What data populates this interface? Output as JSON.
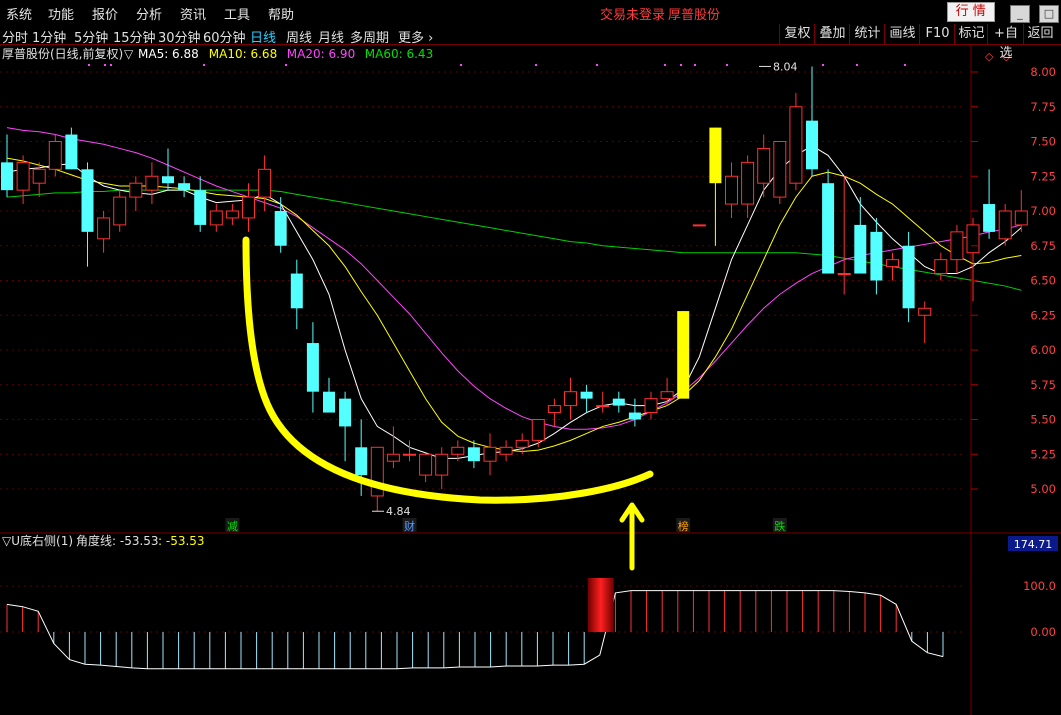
{
  "menubar": {
    "items": [
      "系统",
      "功能",
      "报价",
      "分析",
      "资讯",
      "工具",
      "帮助"
    ],
    "status_text": "交易未登录",
    "stock_name": "厚普股份",
    "quote_button": "行 情"
  },
  "periodbar": {
    "periods": [
      "分时",
      "1分钟",
      "5分钟",
      "15分钟",
      "30分钟",
      "60分钟",
      "日线",
      "周线",
      "月线",
      "多周期",
      "更多"
    ],
    "active": "日线",
    "tools": [
      "复权",
      "叠加",
      "统计",
      "画线",
      "F10",
      "标记",
      "+自选",
      "返回"
    ]
  },
  "main_header": {
    "title": "厚普股份(日线,前复权)",
    "marker": "▽",
    "ma": [
      {
        "label": "MA5: 6.88",
        "color": "#ffffff"
      },
      {
        "label": "MA10: 6.68",
        "color": "#ffff00"
      },
      {
        "label": "MA20: 6.90",
        "color": "#ff44ff"
      },
      {
        "label": "MA60: 6.43",
        "color": "#00e000"
      }
    ]
  },
  "indicator_header": {
    "name": "▽U底右侧(1)",
    "label": "角度线: -53.53",
    "value": ": -53.53",
    "right_box": "174.71"
  },
  "chart_data": [
    {
      "type": "candlestick",
      "title": "厚普股份(日线,前复权)",
      "ylim": [
        4.8,
        8.1
      ],
      "y_ticks": [
        "8.00",
        "7.75",
        "7.50",
        "7.25",
        "7.00",
        "6.75",
        "6.50",
        "6.25",
        "6.00",
        "5.75",
        "5.50",
        "5.25",
        "5.00"
      ],
      "high_label": "8.04",
      "low_label": "4.84",
      "event_labels": [
        {
          "text": "减",
          "color": "#00e000",
          "bar": 14
        },
        {
          "text": "财",
          "color": "#5a9cff",
          "bar": 25
        },
        {
          "text": "榜",
          "color": "#ffa000",
          "bar": 42
        },
        {
          "text": "跌",
          "color": "#00e000",
          "bar": 48
        }
      ],
      "candles": [
        [
          7.35,
          7.55,
          7.1,
          7.15
        ],
        [
          7.15,
          7.4,
          7.05,
          7.35
        ],
        [
          7.2,
          7.35,
          7.1,
          7.3
        ],
        [
          7.3,
          7.55,
          7.25,
          7.5
        ],
        [
          7.55,
          7.6,
          7.3,
          7.3
        ],
        [
          7.3,
          7.35,
          6.6,
          6.85
        ],
        [
          6.8,
          7.0,
          6.7,
          6.95
        ],
        [
          6.9,
          7.15,
          6.85,
          7.1
        ],
        [
          7.1,
          7.25,
          7.0,
          7.2
        ],
        [
          7.15,
          7.35,
          7.05,
          7.25
        ],
        [
          7.25,
          7.45,
          7.15,
          7.2
        ],
        [
          7.2,
          7.25,
          7.1,
          7.15
        ],
        [
          7.15,
          7.25,
          6.85,
          6.9
        ],
        [
          6.9,
          7.05,
          6.85,
          7.0
        ],
        [
          6.95,
          7.05,
          6.9,
          7.0
        ],
        [
          6.95,
          7.2,
          6.85,
          7.1
        ],
        [
          7.1,
          7.4,
          7.0,
          7.3
        ],
        [
          7.0,
          7.1,
          6.7,
          6.75
        ],
        [
          6.55,
          6.65,
          6.15,
          6.3
        ],
        [
          6.05,
          6.2,
          5.55,
          5.7
        ],
        [
          5.7,
          5.8,
          5.55,
          5.55
        ],
        [
          5.65,
          5.7,
          5.2,
          5.45
        ],
        [
          5.3,
          5.5,
          4.95,
          5.1
        ],
        [
          4.95,
          5.3,
          4.84,
          5.3
        ],
        [
          5.2,
          5.45,
          5.15,
          5.25
        ],
        [
          5.25,
          5.35,
          5.2,
          5.25
        ],
        [
          5.1,
          5.25,
          5.05,
          5.25
        ],
        [
          5.1,
          5.3,
          5.0,
          5.25
        ],
        [
          5.25,
          5.35,
          5.2,
          5.3
        ],
        [
          5.3,
          5.35,
          5.15,
          5.2
        ],
        [
          5.2,
          5.4,
          5.1,
          5.3
        ],
        [
          5.25,
          5.35,
          5.2,
          5.3
        ],
        [
          5.3,
          5.4,
          5.25,
          5.35
        ],
        [
          5.35,
          5.5,
          5.3,
          5.5
        ],
        [
          5.55,
          5.65,
          5.45,
          5.6
        ],
        [
          5.6,
          5.8,
          5.5,
          5.7
        ],
        [
          5.7,
          5.75,
          5.55,
          5.65
        ],
        [
          5.6,
          5.7,
          5.55,
          5.6
        ],
        [
          5.65,
          5.7,
          5.55,
          5.6
        ],
        [
          5.55,
          5.65,
          5.45,
          5.5
        ],
        [
          5.55,
          5.7,
          5.5,
          5.65
        ],
        [
          5.65,
          5.8,
          5.6,
          5.7
        ],
        [
          5.65,
          6.28,
          5.65,
          6.28
        ],
        [
          6.9,
          6.9,
          6.9,
          6.9
        ],
        [
          7.2,
          7.6,
          6.75,
          7.6
        ],
        [
          7.05,
          7.35,
          6.95,
          7.25
        ],
        [
          7.05,
          7.4,
          6.95,
          7.35
        ],
        [
          7.2,
          7.55,
          7.1,
          7.45
        ],
        [
          7.1,
          7.5,
          7.05,
          7.5
        ],
        [
          7.2,
          7.85,
          7.15,
          7.75
        ],
        [
          7.65,
          8.04,
          7.25,
          7.3
        ],
        [
          7.2,
          7.3,
          6.8,
          6.55
        ],
        [
          6.55,
          7.25,
          6.4,
          6.55
        ],
        [
          6.9,
          7.1,
          6.7,
          6.55
        ],
        [
          6.85,
          6.95,
          6.4,
          6.5
        ],
        [
          6.6,
          6.7,
          6.5,
          6.65
        ],
        [
          6.75,
          6.85,
          6.2,
          6.3
        ],
        [
          6.25,
          6.35,
          6.05,
          6.3
        ],
        [
          6.55,
          6.7,
          6.5,
          6.65
        ],
        [
          6.65,
          6.9,
          6.55,
          6.85
        ],
        [
          6.7,
          6.95,
          6.35,
          6.9
        ],
        [
          7.05,
          7.3,
          6.8,
          6.85
        ],
        [
          6.8,
          7.05,
          6.75,
          7.0
        ],
        [
          6.9,
          7.15,
          6.85,
          7.0
        ]
      ],
      "ma5": [
        7.28,
        7.3,
        7.31,
        7.33,
        7.34,
        7.25,
        7.18,
        7.15,
        7.13,
        7.12,
        7.15,
        7.15,
        7.1,
        7.06,
        7.07,
        7.08,
        7.12,
        7.05,
        6.85,
        6.65,
        6.4,
        6.0,
        5.65,
        5.45,
        5.38,
        5.3,
        5.26,
        5.22,
        5.22,
        5.24,
        5.26,
        5.27,
        5.29,
        5.33,
        5.4,
        5.48,
        5.55,
        5.6,
        5.62,
        5.6,
        5.6,
        5.63,
        5.72,
        5.95,
        6.3,
        6.65,
        6.9,
        7.15,
        7.3,
        7.4,
        7.47,
        7.4,
        7.25,
        7.05,
        6.92,
        6.8,
        6.7,
        6.6,
        6.55,
        6.55,
        6.6,
        6.7,
        6.78,
        6.88
      ],
      "ma10": [
        7.38,
        7.36,
        7.33,
        7.3,
        7.26,
        7.22,
        7.2,
        7.18,
        7.18,
        7.18,
        7.17,
        7.16,
        7.14,
        7.12,
        7.11,
        7.1,
        7.09,
        7.05,
        6.97,
        6.86,
        6.75,
        6.6,
        6.42,
        6.25,
        6.05,
        5.85,
        5.65,
        5.48,
        5.38,
        5.33,
        5.3,
        5.28,
        5.27,
        5.28,
        5.31,
        5.35,
        5.4,
        5.45,
        5.48,
        5.52,
        5.56,
        5.6,
        5.67,
        5.78,
        5.95,
        6.15,
        6.4,
        6.65,
        6.9,
        7.1,
        7.25,
        7.28,
        7.25,
        7.2,
        7.12,
        7.05,
        6.95,
        6.85,
        6.75,
        6.68,
        6.62,
        6.63,
        6.66,
        6.68
      ],
      "ma20": [
        7.6,
        7.58,
        7.57,
        7.55,
        7.52,
        7.5,
        7.48,
        7.45,
        7.42,
        7.38,
        7.33,
        7.28,
        7.23,
        7.18,
        7.14,
        7.1,
        7.06,
        7.02,
        6.96,
        6.88,
        6.8,
        6.72,
        6.62,
        6.5,
        6.38,
        6.26,
        6.12,
        5.98,
        5.85,
        5.74,
        5.65,
        5.58,
        5.52,
        5.48,
        5.45,
        5.43,
        5.43,
        5.44,
        5.46,
        5.5,
        5.56,
        5.62,
        5.7,
        5.8,
        5.92,
        6.05,
        6.18,
        6.3,
        6.4,
        6.48,
        6.55,
        6.6,
        6.65,
        6.68,
        6.7,
        6.72,
        6.74,
        6.76,
        6.78,
        6.8,
        6.82,
        6.85,
        6.87,
        6.9
      ],
      "ma60": [
        7.1,
        7.11,
        7.12,
        7.13,
        7.13,
        7.14,
        7.14,
        7.15,
        7.15,
        7.15,
        7.15,
        7.15,
        7.15,
        7.15,
        7.15,
        7.15,
        7.15,
        7.14,
        7.12,
        7.1,
        7.08,
        7.06,
        7.04,
        7.02,
        7.0,
        6.98,
        6.96,
        6.94,
        6.92,
        6.9,
        6.88,
        6.86,
        6.84,
        6.82,
        6.8,
        6.78,
        6.77,
        6.75,
        6.74,
        6.73,
        6.72,
        6.71,
        6.7,
        6.7,
        6.7,
        6.7,
        6.7,
        6.7,
        6.7,
        6.7,
        6.69,
        6.68,
        6.66,
        6.64,
        6.62,
        6.6,
        6.58,
        6.56,
        6.54,
        6.52,
        6.5,
        6.48,
        6.46,
        6.43
      ]
    },
    {
      "type": "bar",
      "title": "U底右侧(1)",
      "ylim": [
        -50,
        130
      ],
      "y_ticks": [
        "100.0",
        "0.00"
      ],
      "highlight_bar": 38,
      "values": [
        60,
        55,
        45,
        -25,
        -60,
        -70,
        -72,
        -75,
        -78,
        -80,
        -80,
        -80,
        -80,
        -80,
        -80,
        -80,
        -80,
        -80,
        -80,
        -80,
        -80,
        -80,
        -80,
        -80,
        -80,
        -80,
        -78,
        -78,
        -78,
        -76,
        -76,
        -76,
        -74,
        -74,
        -74,
        -72,
        -72,
        -70,
        -50,
        85,
        90,
        90,
        90,
        90,
        90,
        90,
        90,
        90,
        90,
        90,
        90,
        90,
        90,
        90,
        88,
        85,
        80,
        60,
        -20,
        -45,
        -53.53
      ]
    }
  ]
}
